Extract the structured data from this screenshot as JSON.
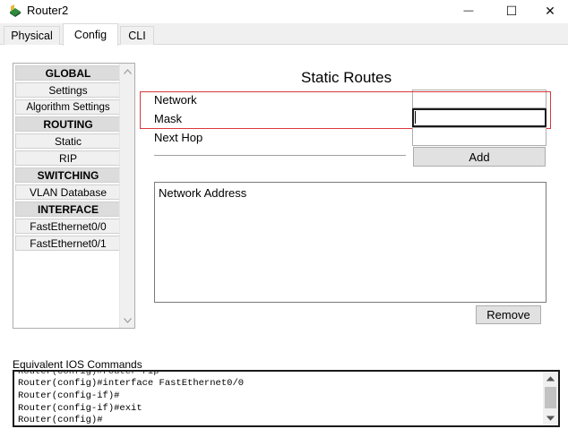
{
  "window": {
    "title": "Router2",
    "minimize_glyph": "—",
    "maximize_glyph": "☐",
    "close_glyph": "✕"
  },
  "tabs": [
    {
      "label": "Physical",
      "active": false
    },
    {
      "label": "Config",
      "active": true
    },
    {
      "label": "CLI",
      "active": false
    }
  ],
  "nav": {
    "items": [
      {
        "label": "GLOBAL",
        "header": true
      },
      {
        "label": "Settings",
        "header": false
      },
      {
        "label": "Algorithm Settings",
        "header": false
      },
      {
        "label": "ROUTING",
        "header": true
      },
      {
        "label": "Static",
        "header": false
      },
      {
        "label": "RIP",
        "header": false
      },
      {
        "label": "SWITCHING",
        "header": true
      },
      {
        "label": "VLAN Database",
        "header": false
      },
      {
        "label": "INTERFACE",
        "header": true
      },
      {
        "label": "FastEthernet0/0",
        "header": false
      },
      {
        "label": "FastEthernet0/1",
        "header": false
      }
    ]
  },
  "static_routes": {
    "title": "Static Routes",
    "network_label": "Network",
    "network_value": "",
    "mask_label": "Mask",
    "mask_value": "",
    "next_hop_label": "Next Hop",
    "next_hop_value": "",
    "add_label": "Add",
    "list_header": "Network Address",
    "remove_label": "Remove"
  },
  "ios": {
    "label": "Equivalent IOS Commands",
    "lines": [
      "Router(config)#interface FastEthernet0/0",
      "Router(config-if)#",
      "Router(config-if)#exit",
      "Router(config)#"
    ]
  },
  "colors": {
    "highlight_border": "#d9383a"
  }
}
